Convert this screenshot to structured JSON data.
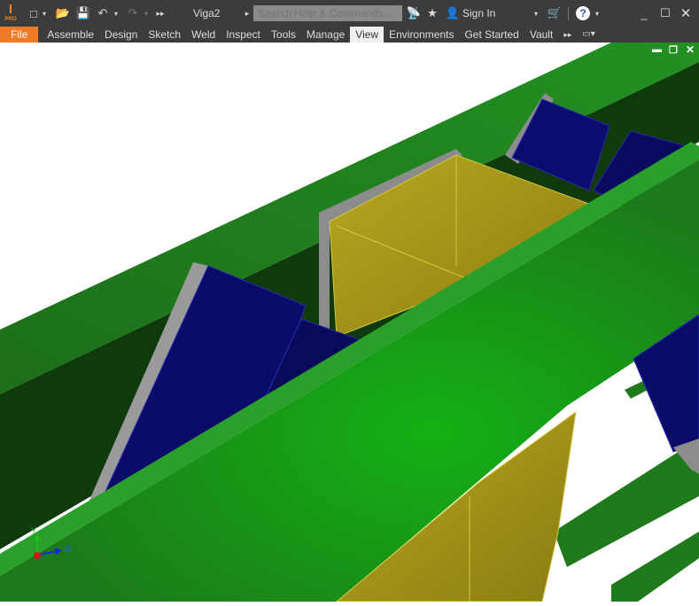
{
  "app": {
    "logo_text": "I",
    "logo_sub": "PRO",
    "document_title": "Viga2"
  },
  "search": {
    "placeholder": "Search Help & Commands..."
  },
  "account": {
    "sign_in": "Sign In"
  },
  "quick_access": {
    "icons": [
      "new-icon",
      "open-icon",
      "save-icon",
      "undo-icon",
      "redo-icon",
      "more-icon"
    ]
  },
  "ribbon": {
    "tabs": [
      {
        "label": "File"
      },
      {
        "label": "Assemble"
      },
      {
        "label": "Design"
      },
      {
        "label": "Sketch"
      },
      {
        "label": "Weld"
      },
      {
        "label": "Inspect"
      },
      {
        "label": "Tools"
      },
      {
        "label": "Manage"
      },
      {
        "label": "View",
        "active": true
      },
      {
        "label": "Environments"
      },
      {
        "label": "Get Started"
      },
      {
        "label": "Vault"
      }
    ]
  },
  "viewport": {
    "triad": {
      "y": "Y",
      "z": "Z"
    },
    "colors": {
      "beam": "#1f8a1a",
      "column": "#a89a1a",
      "tubes": "#0b0b6a",
      "accent": "#f0792a"
    }
  }
}
